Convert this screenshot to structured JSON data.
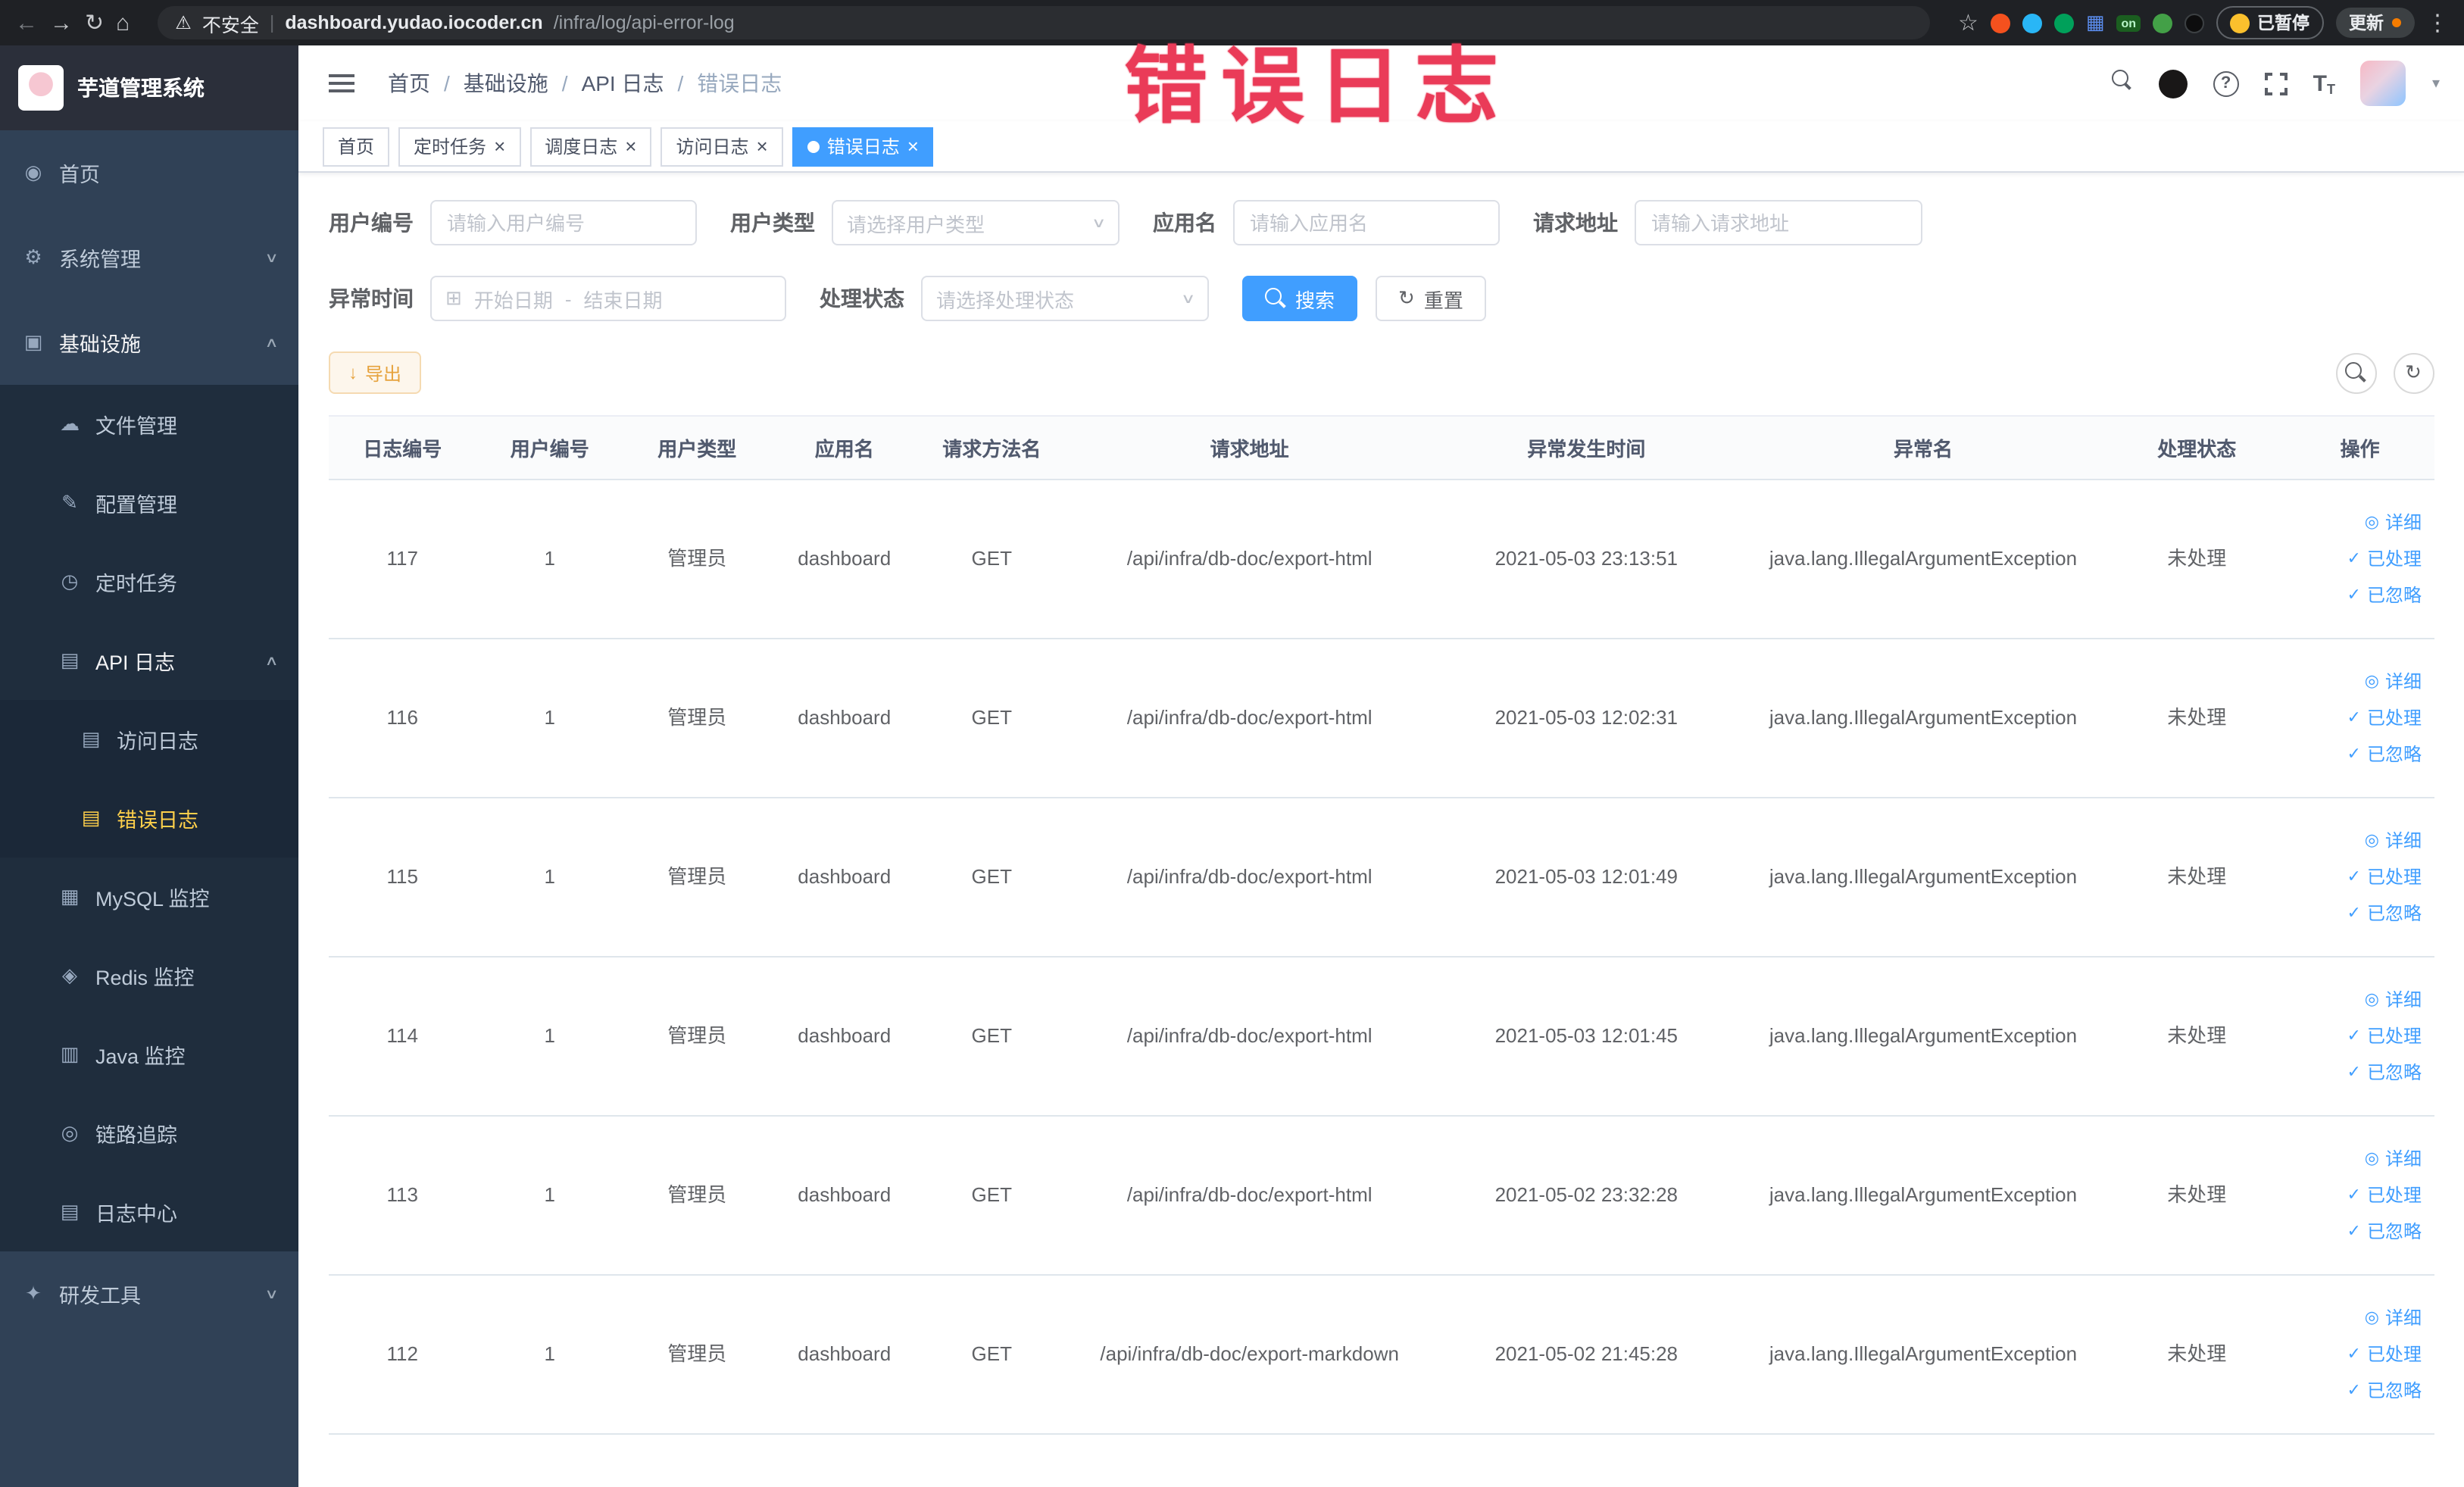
{
  "browser": {
    "security_label": "不安全",
    "url_host": "dashboard.yudao.iocoder.cn",
    "url_path": "/infra/log/api-error-log",
    "on_badge": "on",
    "paused_badge": "已暂停",
    "update_button": "更新"
  },
  "annotation": "错误日志",
  "icons": {
    "back": "←",
    "forward": "→",
    "reload": "↻",
    "home": "⌂",
    "warning": "⚠",
    "star": "☆",
    "dots": "⋮",
    "grid_ext": "▦",
    "question": "?",
    "caret_down": "▾",
    "chevron_down": "∨",
    "chevron_up": "∧",
    "close": "×",
    "calendar": "⊞",
    "download": "↓",
    "eye": "◎",
    "check": "✓",
    "refresh": "↻",
    "separator": "-",
    "font_big": "T",
    "font_small": "T"
  },
  "sidebar": {
    "logo_title": "芋道管理系统",
    "items": [
      {
        "label": "首页",
        "icon": "◉"
      },
      {
        "label": "系统管理",
        "icon": "⚙"
      },
      {
        "label": "基础设施",
        "icon": "▣"
      },
      {
        "label": "文件管理",
        "icon": "☁"
      },
      {
        "label": "配置管理",
        "icon": "✎"
      },
      {
        "label": "定时任务",
        "icon": "◷"
      },
      {
        "label": "API 日志",
        "icon": "▤"
      },
      {
        "label": "访问日志",
        "icon": "▤"
      },
      {
        "label": "错误日志",
        "icon": "▤"
      },
      {
        "label": "MySQL 监控",
        "icon": "▦"
      },
      {
        "label": "Redis 监控",
        "icon": "◈"
      },
      {
        "label": "Java 监控",
        "icon": "▥"
      },
      {
        "label": "链路追踪",
        "icon": "◎"
      },
      {
        "label": "日志中心",
        "icon": "▤"
      },
      {
        "label": "研发工具",
        "icon": "✦"
      }
    ]
  },
  "breadcrumb": {
    "separator": "/",
    "items": [
      "首页",
      "基础设施",
      "API 日志",
      "错误日志"
    ]
  },
  "tags": [
    {
      "label": "首页"
    },
    {
      "label": "定时任务"
    },
    {
      "label": "调度日志"
    },
    {
      "label": "访问日志"
    },
    {
      "label": "错误日志"
    }
  ],
  "filters": {
    "user_id_label": "用户编号",
    "user_id_placeholder": "请输入用户编号",
    "user_type_label": "用户类型",
    "user_type_placeholder": "请选择用户类型",
    "app_name_label": "应用名",
    "app_name_placeholder": "请输入应用名",
    "request_url_label": "请求地址",
    "request_url_placeholder": "请输入请求地址",
    "time_label": "异常时间",
    "time_start_placeholder": "开始日期",
    "time_end_placeholder": "结束日期",
    "status_label": "处理状态",
    "status_placeholder": "请选择处理状态",
    "search_button": "搜索",
    "reset_button": "重置"
  },
  "toolbar": {
    "export_button": "导出"
  },
  "table": {
    "columns": [
      "日志编号",
      "用户编号",
      "用户类型",
      "应用名",
      "请求方法名",
      "请求地址",
      "异常发生时间",
      "异常名",
      "处理状态",
      "操作"
    ],
    "actions": [
      "详细",
      "已处理",
      "已忽略"
    ],
    "rows": [
      {
        "id": "117",
        "user_id": "1",
        "user_type": "管理员",
        "app": "dashboard",
        "method": "GET",
        "url": "/api/infra/db-doc/export-html",
        "time": "2021-05-03 23:13:51",
        "exception": "java.lang.IllegalArgumentException",
        "status": "未处理"
      },
      {
        "id": "116",
        "user_id": "1",
        "user_type": "管理员",
        "app": "dashboard",
        "method": "GET",
        "url": "/api/infra/db-doc/export-html",
        "time": "2021-05-03 12:02:31",
        "exception": "java.lang.IllegalArgumentException",
        "status": "未处理"
      },
      {
        "id": "115",
        "user_id": "1",
        "user_type": "管理员",
        "app": "dashboard",
        "method": "GET",
        "url": "/api/infra/db-doc/export-html",
        "time": "2021-05-03 12:01:49",
        "exception": "java.lang.IllegalArgumentException",
        "status": "未处理"
      },
      {
        "id": "114",
        "user_id": "1",
        "user_type": "管理员",
        "app": "dashboard",
        "method": "GET",
        "url": "/api/infra/db-doc/export-html",
        "time": "2021-05-03 12:01:45",
        "exception": "java.lang.IllegalArgumentException",
        "status": "未处理"
      },
      {
        "id": "113",
        "user_id": "1",
        "user_type": "管理员",
        "app": "dashboard",
        "method": "GET",
        "url": "/api/infra/db-doc/export-html",
        "time": "2021-05-02 23:32:28",
        "exception": "java.lang.IllegalArgumentException",
        "status": "未处理"
      },
      {
        "id": "112",
        "user_id": "1",
        "user_type": "管理员",
        "app": "dashboard",
        "method": "GET",
        "url": "/api/infra/db-doc/export-markdown",
        "time": "2021-05-02 21:45:28",
        "exception": "java.lang.IllegalArgumentException",
        "status": "未处理"
      }
    ]
  }
}
